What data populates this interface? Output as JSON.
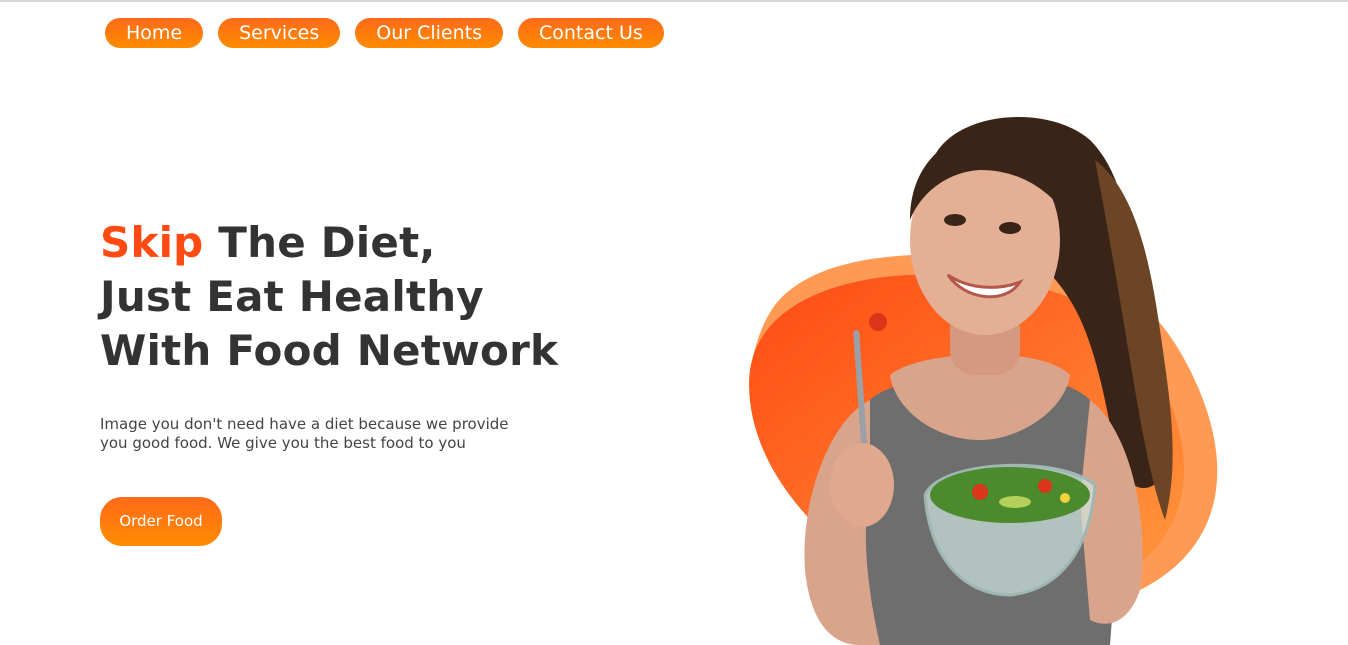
{
  "nav": {
    "items": [
      {
        "label": "Home"
      },
      {
        "label": "Services"
      },
      {
        "label": "Our Clients"
      },
      {
        "label": "Contact Us"
      }
    ]
  },
  "hero": {
    "title_accent": "Skip",
    "title_rest_line1": " The Diet,",
    "title_line2": "Just Eat Healthy",
    "title_line3": "With Food Network",
    "description_line1": "Image you don't need have a diet because we provide",
    "description_line2": "you good food. We give you the best food to you",
    "cta_label": "Order Food"
  },
  "colors": {
    "accent": "#ff4a12",
    "button_gradient_start": "#ff6a1a",
    "button_gradient_end": "#ff8c00",
    "heading_text": "#333333"
  },
  "images": {
    "hero_photo": "woman-eating-salad-icon"
  }
}
